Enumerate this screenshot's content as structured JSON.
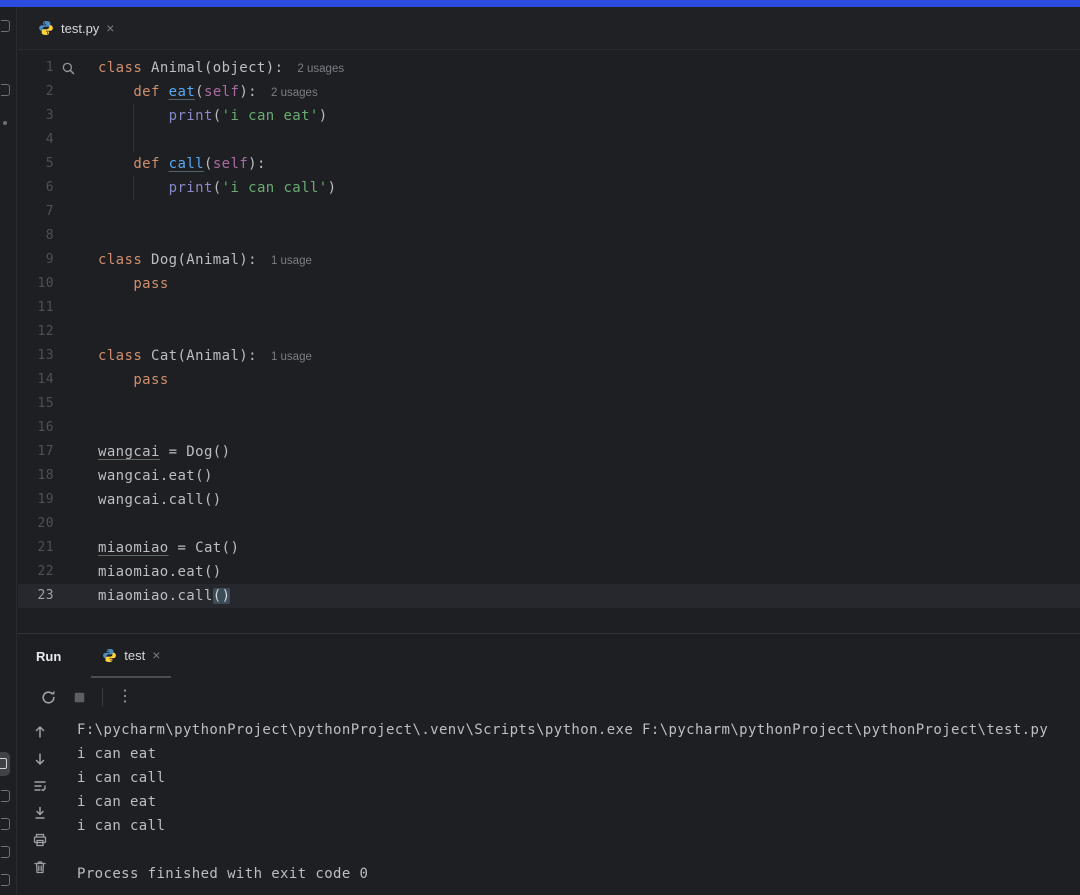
{
  "colors": {
    "accent_bar": "#2c4ce0",
    "background": "#1e1f22",
    "current_line_bg": "#26282e",
    "keyword": "#cf8e6d",
    "string": "#6aab73",
    "function_declaration": "#56a8f5",
    "builtin": "#8888c6",
    "self_parameter": "#ab6ba5",
    "default_text": "#bcbec4",
    "line_number": "#4b5059",
    "inlay_hint": "#7a7e85",
    "brace_match_bg": "#3b4b57"
  },
  "editor_tabs": {
    "active_tab": {
      "label": "test.py",
      "close": "×",
      "icon": "python-icon"
    }
  },
  "editor": {
    "lines": [
      {
        "n": 1,
        "gicon": true,
        "inlay": "2 usages",
        "tokens": [
          {
            "c": "kw",
            "t": "class"
          },
          {
            "c": "pl",
            "t": " Animal(object):"
          }
        ]
      },
      {
        "n": 2,
        "inlay": "2 usages",
        "tokens": [
          {
            "c": "pl",
            "t": "    "
          },
          {
            "c": "kw",
            "t": "def"
          },
          {
            "c": "pl",
            "t": " "
          },
          {
            "c": "fn",
            "t": "eat"
          },
          {
            "c": "pl",
            "t": "("
          },
          {
            "c": "slf",
            "t": "self"
          },
          {
            "c": "pl",
            "t": "):"
          }
        ]
      },
      {
        "n": 3,
        "guide": true,
        "tokens": [
          {
            "c": "pl",
            "t": "        "
          },
          {
            "c": "bi",
            "t": "print"
          },
          {
            "c": "pl",
            "t": "("
          },
          {
            "c": "str",
            "t": "'i can eat'"
          },
          {
            "c": "pl",
            "t": ")"
          }
        ]
      },
      {
        "n": 4,
        "guide": true,
        "tokens": []
      },
      {
        "n": 5,
        "tokens": [
          {
            "c": "pl",
            "t": "    "
          },
          {
            "c": "kw",
            "t": "def"
          },
          {
            "c": "pl",
            "t": " "
          },
          {
            "c": "fn",
            "t": "call"
          },
          {
            "c": "pl",
            "t": "("
          },
          {
            "c": "slf",
            "t": "self"
          },
          {
            "c": "pl",
            "t": "):"
          }
        ]
      },
      {
        "n": 6,
        "guide": true,
        "tokens": [
          {
            "c": "pl",
            "t": "        "
          },
          {
            "c": "bi",
            "t": "print"
          },
          {
            "c": "pl",
            "t": "("
          },
          {
            "c": "str",
            "t": "'i can call'"
          },
          {
            "c": "pl",
            "t": ")"
          }
        ]
      },
      {
        "n": 7,
        "tokens": []
      },
      {
        "n": 8,
        "tokens": []
      },
      {
        "n": 9,
        "inlay": "1 usage",
        "tokens": [
          {
            "c": "kw",
            "t": "class"
          },
          {
            "c": "pl",
            "t": " Dog(Animal):"
          }
        ]
      },
      {
        "n": 10,
        "tokens": [
          {
            "c": "pl",
            "t": "    "
          },
          {
            "c": "kw",
            "t": "pass"
          }
        ]
      },
      {
        "n": 11,
        "tokens": []
      },
      {
        "n": 12,
        "tokens": []
      },
      {
        "n": 13,
        "inlay": "1 usage",
        "tokens": [
          {
            "c": "kw",
            "t": "class"
          },
          {
            "c": "pl",
            "t": " Cat(Animal):"
          }
        ]
      },
      {
        "n": 14,
        "tokens": [
          {
            "c": "pl",
            "t": "    "
          },
          {
            "c": "kw",
            "t": "pass"
          }
        ]
      },
      {
        "n": 15,
        "tokens": []
      },
      {
        "n": 16,
        "tokens": []
      },
      {
        "n": 17,
        "tokens": [
          {
            "c": "id-u",
            "t": "wangcai"
          },
          {
            "c": "pl",
            "t": " = Dog()"
          }
        ]
      },
      {
        "n": 18,
        "tokens": [
          {
            "c": "pl",
            "t": "wangcai.eat()"
          }
        ]
      },
      {
        "n": 19,
        "tokens": [
          {
            "c": "pl",
            "t": "wangcai.call()"
          }
        ]
      },
      {
        "n": 20,
        "tokens": []
      },
      {
        "n": 21,
        "tokens": [
          {
            "c": "id-u",
            "t": "miaomiao"
          },
          {
            "c": "pl",
            "t": " = Cat()"
          }
        ]
      },
      {
        "n": 22,
        "tokens": [
          {
            "c": "pl",
            "t": "miaomiao.eat()"
          }
        ]
      },
      {
        "n": 23,
        "current": true,
        "tokens": [
          {
            "c": "pl",
            "t": "miaomiao.call"
          },
          {
            "c": "hl",
            "t": "()"
          }
        ]
      }
    ]
  },
  "run_panel": {
    "title": "Run",
    "tab": {
      "label": "test",
      "close": "×",
      "icon": "python-icon"
    },
    "toolbar_icons": [
      "rerun-icon",
      "stop-icon",
      "more-options-icon"
    ],
    "console_toolbar_icons": [
      "up-arrow-icon",
      "down-arrow-icon",
      "soft-wrap-icon",
      "scroll-to-end-icon",
      "print-icon",
      "clear-output-icon"
    ],
    "console_lines": [
      "F:\\pycharm\\pythonProject\\pythonProject\\.venv\\Scripts\\python.exe F:\\pycharm\\pythonProject\\pythonProject\\test.py",
      "i can eat",
      "i can call",
      "i can eat",
      "i can call",
      "",
      "Process finished with exit code 0"
    ]
  }
}
